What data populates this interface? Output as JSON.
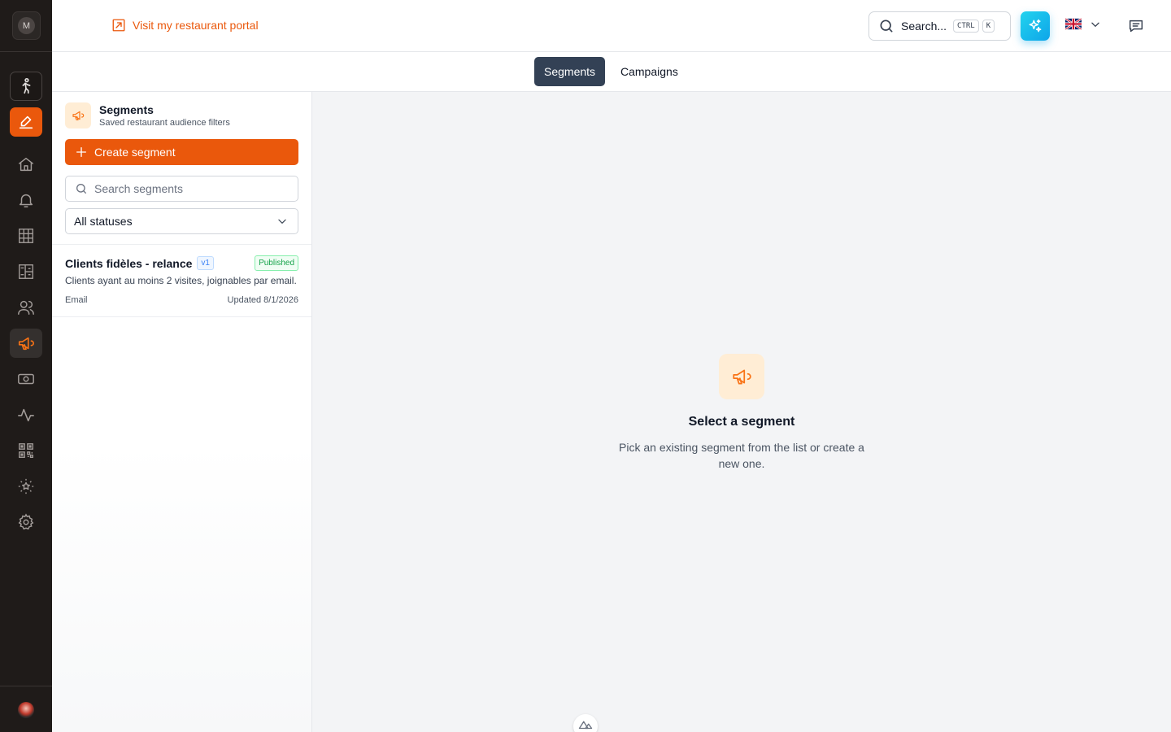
{
  "rail": {
    "avatar_initial": "M",
    "items": [
      {
        "name": "rail-item-walkthrough",
        "icon": "walking-person-icon"
      },
      {
        "name": "rail-item-edit",
        "icon": "pencil-icon"
      },
      {
        "name": "rail-item-home",
        "icon": "home-icon"
      },
      {
        "name": "rail-item-notifications",
        "icon": "bell-icon"
      },
      {
        "name": "rail-item-calendar",
        "icon": "grid-icon"
      },
      {
        "name": "rail-item-floorplan",
        "icon": "floorplan-icon"
      },
      {
        "name": "rail-item-customers",
        "icon": "users-icon"
      },
      {
        "name": "rail-item-marketing",
        "icon": "megaphone-icon"
      },
      {
        "name": "rail-item-payments",
        "icon": "banknote-icon"
      },
      {
        "name": "rail-item-analytics",
        "icon": "activity-icon"
      },
      {
        "name": "rail-item-qr",
        "icon": "qr-code-icon"
      },
      {
        "name": "rail-item-reviews",
        "icon": "star-badge-icon"
      },
      {
        "name": "rail-item-settings",
        "icon": "gear-icon"
      }
    ],
    "active_item": "rail-item-marketing",
    "accent": "#ea580c"
  },
  "header": {
    "portal_link": "Visit my restaurant portal",
    "search_label": "Search...",
    "shortcut_keys": [
      "CTRL",
      "K"
    ],
    "language": "English (UK flag)"
  },
  "tabs": [
    {
      "label": "Segments",
      "active": true
    },
    {
      "label": "Campaigns",
      "active": false
    }
  ],
  "panel": {
    "title": "Segments",
    "subtitle": "Saved restaurant audience filters",
    "create_label": "Create segment",
    "search_placeholder": "Search segments",
    "status_filter": "All statuses"
  },
  "segments": [
    {
      "name": "Clients fidèles - relance",
      "version": "v1",
      "status": "Published",
      "description": "Clients ayant au moins 2 visites, joignables par email.",
      "channel": "Email",
      "updated": "Updated 8/1/2026"
    }
  ],
  "empty_state": {
    "title": "Select a segment",
    "text": "Pick an existing segment from the list or create a new one."
  },
  "colors": {
    "brand_orange": "#ea580c",
    "active_tab": "#334155",
    "published_green": "#16a34a",
    "version_blue": "#3b82f6",
    "ai_gradient": "#0ea5e9"
  }
}
